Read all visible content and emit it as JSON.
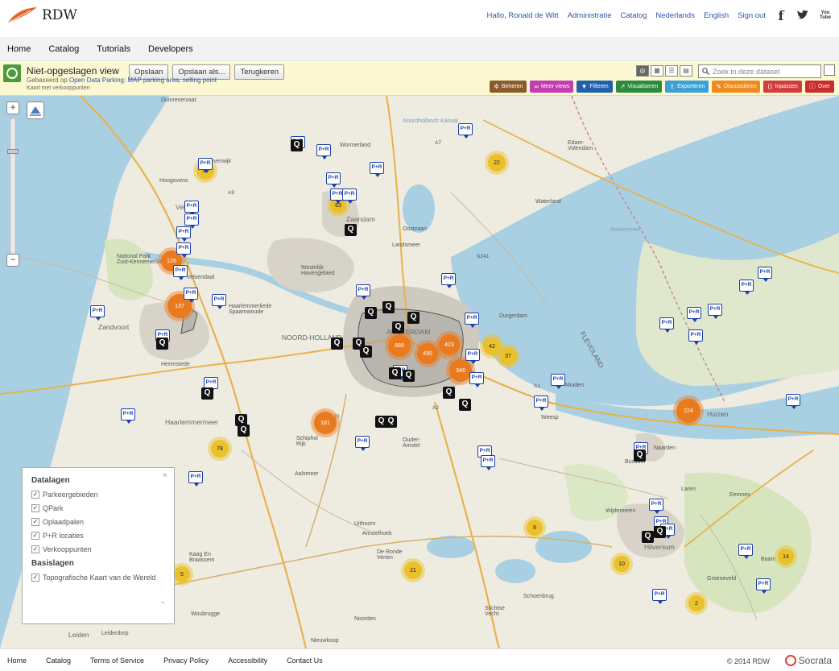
{
  "brand": {
    "name": "RDW",
    "accent": "#e2662a"
  },
  "toplinks": [
    "Hallo, Ronald de Witt",
    "Administratie",
    "Catalog",
    "Nederlands",
    "English",
    "Sign out"
  ],
  "social": [
    "facebook-icon",
    "twitter-icon",
    "youtube-icon"
  ],
  "youtube_label": "You Tube",
  "nav": [
    "Home",
    "Catalog",
    "Tutorials",
    "Developers"
  ],
  "view": {
    "title": "Niet-opgeslagen view",
    "buttons": [
      "Opslaan",
      "Opslaan als...",
      "Terugkeren"
    ],
    "based_on_prefix": "Gebaseerd op",
    "based_on_link": "Open Data Parking: MAP parking area, selling point",
    "subtitle": "Kaart met verkooppunten"
  },
  "search": {
    "placeholder": "Zoek in deze dataset"
  },
  "toolbar": [
    {
      "label": "Beheren",
      "color": "#8a5a2b",
      "icon": "gear-icon"
    },
    {
      "label": "Meer views",
      "color": "#c23cb2",
      "icon": "glasses-icon"
    },
    {
      "label": "Filteren",
      "color": "#2160ad",
      "icon": "filter-icon"
    },
    {
      "label": "Visualiseren",
      "color": "#2b8a3e",
      "icon": "chart-icon"
    },
    {
      "label": "Exporteren",
      "color": "#3ba0d8",
      "icon": "export-icon"
    },
    {
      "label": "Discussiëren",
      "color": "#f08a1f",
      "icon": "speech-icon"
    },
    {
      "label": "Inpassen",
      "color": "#d33c3c",
      "icon": "embed-icon"
    },
    {
      "label": "Over",
      "color": "#cc2b2b",
      "icon": "info-icon"
    }
  ],
  "map": {
    "labels": {
      "duinresevaat": "Duinreservaat",
      "beverwijk": "Beverwijk",
      "hoogovens": "Hoogovens",
      "velsen": "Velsen",
      "wormerland": "Wormerland",
      "zaandam": "Zaandam",
      "noordhollandskanaal": "Noordhollands Kanaal",
      "edam_volendam": "Edam-\nVolendam",
      "nationalpark": "National Park\nZuid-Kennemerland",
      "wemendaal": "Velsendaal",
      "haarlemmerliede": "Haarlemmerliede\nSpaarnwoude",
      "zandvoort": "Zandvoort",
      "westelijk": "Westelijk\nHavengebied",
      "noordholland": "NOORD-HOLLAND",
      "amsterdam": "AMSTERDAM",
      "durgerdam": "Durgerdam",
      "flevoland": "FLEVOLAND",
      "markermeer": "Markermeer",
      "waterland": "Waterland",
      "oostzaan": "Oostzaan",
      "landsmeer": "Landsmeer",
      "heemstede": "Heemstede",
      "haarlemmermeer": "Haarlemmermeer",
      "schiphol": "Schiphol\nRijk",
      "ouderamstel": "Ouder-\nAmstel",
      "weesp": "Weesp",
      "muiden": "Muiden",
      "huizen": "Huizen",
      "bussum": "Bussum",
      "naarden": "Naarden",
      "laren": "Laren",
      "eemnes": "Eemnes",
      "wijdemeren": "Wijdemeren",
      "hilversum": "Hilversum",
      "baarn": "Baarn",
      "groeneveld": "Groeneveld",
      "kaag": "Kaag En\nBraassem",
      "woubrugge": "Woubrugge",
      "aalsmeer": "Aalsmeer",
      "uithoorn": "Uithoorn",
      "amstelhoek": "Amstelhoek",
      "ronde": "De Ronde\nVenen",
      "schoenbrug": "Schoenbrug",
      "stichtse": "Stichtse\nVecht",
      "noorden": "Noorden",
      "nieuwkoop": "Nieuwkoop",
      "leiden": "Leiden",
      "leiderdorp": "Leiderdorp",
      "a10": "A10",
      "a1": "A1",
      "a2": "A2",
      "a7": "A7",
      "n241": "N241",
      "a9": "A9"
    },
    "clusters": [
      {
        "v": "30",
        "kind": "yellow"
      },
      {
        "v": "22",
        "kind": "yellow"
      },
      {
        "v": "63",
        "kind": "yellow"
      },
      {
        "v": "126",
        "kind": "orange"
      },
      {
        "v": "137",
        "kind": "orange"
      },
      {
        "v": "888",
        "kind": "orange"
      },
      {
        "v": "495",
        "kind": "orange"
      },
      {
        "v": "423",
        "kind": "orange"
      },
      {
        "v": "42",
        "kind": "yellow"
      },
      {
        "v": "37",
        "kind": "yellow"
      },
      {
        "v": "346",
        "kind": "orange"
      },
      {
        "v": "181",
        "kind": "orange"
      },
      {
        "v": "78",
        "kind": "yellow"
      },
      {
        "v": "224",
        "kind": "orange"
      },
      {
        "v": "9",
        "kind": "yellow"
      },
      {
        "v": "10",
        "kind": "yellow"
      },
      {
        "v": "14",
        "kind": "yellow"
      },
      {
        "v": "21",
        "kind": "yellow"
      },
      {
        "v": "2",
        "kind": "yellow"
      },
      {
        "v": "5",
        "kind": "yellow"
      }
    ],
    "pr_label": "P+R",
    "qpark_label": "Q"
  },
  "layers": {
    "title_data": "Datalagen",
    "data_layers": [
      "Parkeergebieden",
      "QPark",
      "Oplaadpalen",
      "P+R locaties",
      "Verkooppunten"
    ],
    "title_base": "Basislagen",
    "base_layers": [
      "Topografische Kaart van de Wereld"
    ],
    "check": "✓",
    "close": "×",
    "collapse": "⌄"
  },
  "footer": {
    "links": [
      "Home",
      "Catalog",
      "Terms of Service",
      "Privacy Policy",
      "Accessibility",
      "Contact Us"
    ],
    "copyright": "© 2014 RDW",
    "powered": "Socrata"
  }
}
